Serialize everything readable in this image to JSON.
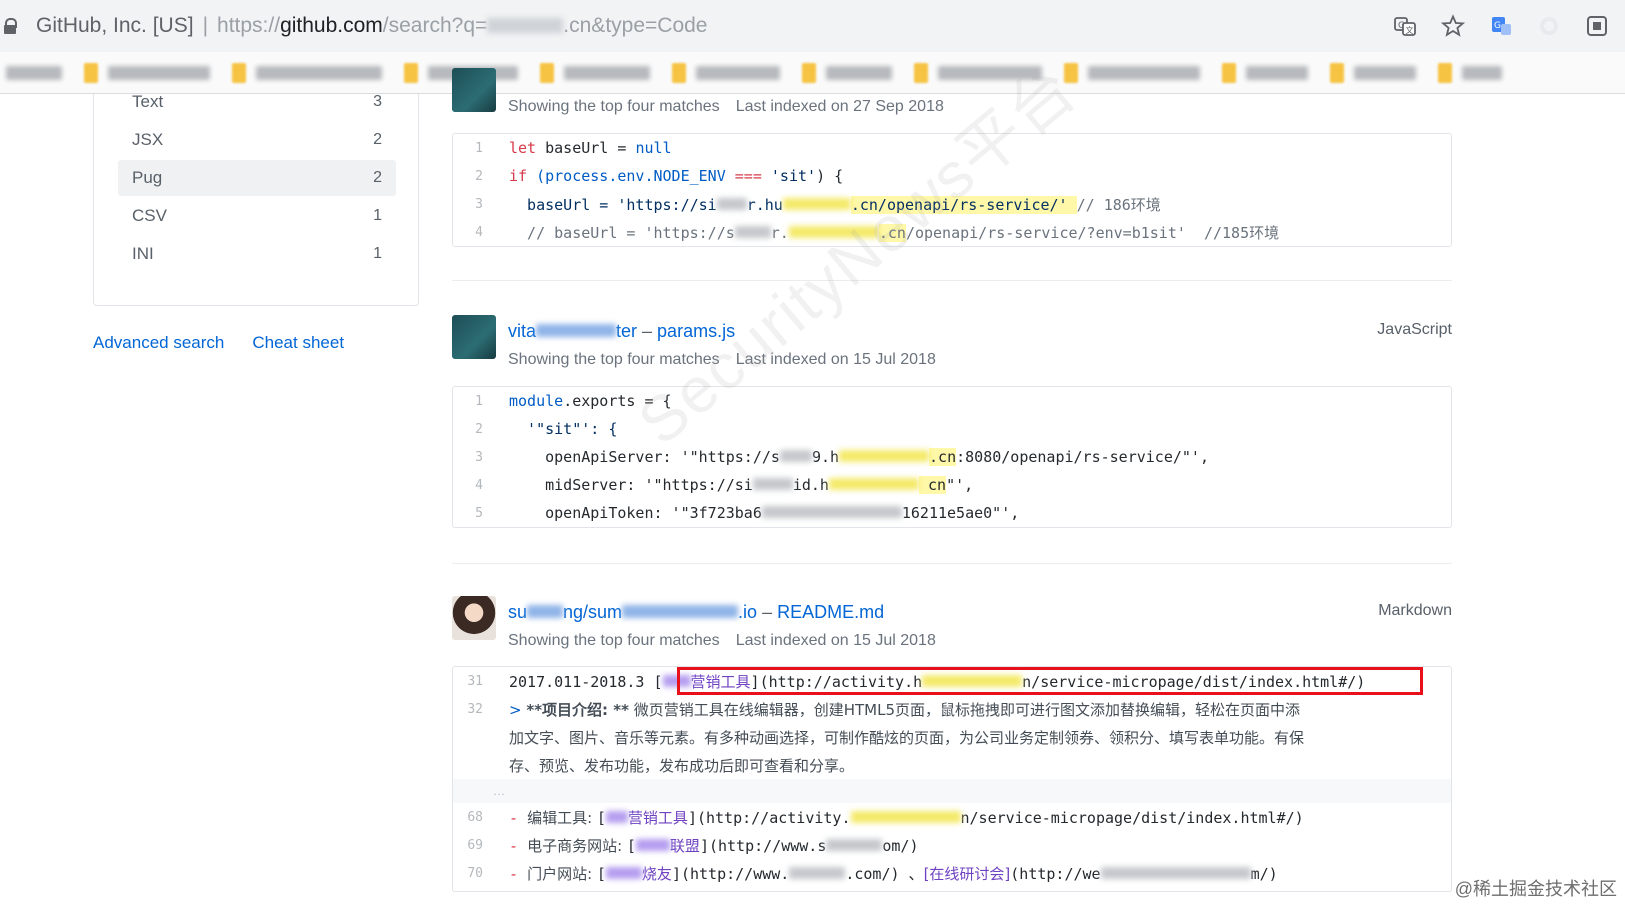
{
  "browser": {
    "site_identity": "GitHub, Inc. [US]",
    "url_prefix": "https://",
    "url_domain": "github.com",
    "url_path": "/search?q=",
    "url_suffix": ".cn&type=Code",
    "icons": [
      "translate-icon",
      "star-icon",
      "extension-icon",
      "profile-icon",
      "window-icon"
    ]
  },
  "bookmarks_bar": {
    "folder_count": 12
  },
  "sidebar": {
    "languages": [
      {
        "name": "Text",
        "count": "3"
      },
      {
        "name": "JSX",
        "count": "2"
      },
      {
        "name": "Pug",
        "count": "2",
        "selected": true
      },
      {
        "name": "CSV",
        "count": "1"
      },
      {
        "name": "INI",
        "count": "1"
      }
    ],
    "advanced_search": "Advanced search",
    "cheat_sheet": "Cheat sheet"
  },
  "results": [
    {
      "meta_matches": "Showing the top four matches",
      "meta_indexed": "Last indexed on 27 Sep 2018",
      "lines": [
        {
          "n": "1",
          "a": "let",
          "b": " baseUrl = ",
          "c": "null"
        },
        {
          "n": "2",
          "a": "if",
          "b": " (process.env.",
          "c": "NODE_ENV",
          "d": " === ",
          "e": "'sit'",
          "f": ") {"
        },
        {
          "n": "3",
          "a": "  baseUrl = 'https://si",
          "b": "r.hu",
          "c": ".cn/openapi/rs-service/' ",
          "d": "// 186环境"
        },
        {
          "n": "4",
          "a": "  // baseUrl = 'https://s",
          "b": "r.",
          "c": ".cn",
          "d": "/openapi/rs-service/?env=b1sit'  //185环境"
        }
      ]
    },
    {
      "repo_prefix": "vita",
      "repo_suffix": "ter",
      "separator": " – ",
      "file": "params.js",
      "language": "JavaScript",
      "meta_matches": "Showing the top four matches",
      "meta_indexed": "Last indexed on 15 Jul 2018",
      "lines": [
        {
          "n": "1",
          "a": "module",
          "b": ".exports = {"
        },
        {
          "n": "2",
          "a": "  '\"sit\"': {"
        },
        {
          "n": "3",
          "a": "    openApiServer: '\"https://s",
          "b": "9.h",
          "c": ".cn",
          "d": ":8080/openapi/rs-service/\"',"
        },
        {
          "n": "4",
          "a": "    midServer: '\"https://si",
          "b": "id.h",
          "c": " cn",
          "d": "\"',"
        },
        {
          "n": "5",
          "a": "    openApiToken: '\"3f723ba6",
          "b": "16211e5ae0\"',"
        }
      ]
    },
    {
      "repo_prefix": "su",
      "repo_mid": "ng/sum",
      "repo_suffix": ".io",
      "separator": " – ",
      "file": "README.md",
      "language": "Markdown",
      "meta_matches": "Showing the top four matches",
      "meta_indexed": "Last indexed on 15 Jul 2018",
      "lines": [
        {
          "n": "31",
          "a": "2017.011-2018.3 ",
          "b": "[",
          "c": "营销工具",
          "d": "](http://activity.h",
          "e": "n/service-micropage/dist/index.html#/)"
        },
        {
          "n": "32",
          "a": "> ",
          "b": "**项目介绍: **",
          "c": " 微页营销工具在线编辑器，创建HTML5页面，鼠标拖拽即可进行图文添加替换编辑，轻松在页面中添"
        },
        {
          "n": "",
          "a": "加文字、图片、音乐等元素。有多种动画选择，可制作酷炫的页面，为公司业务定制领券、领积分、填写表单功能。有保"
        },
        {
          "n": "",
          "a": "存、预览、发布功能，发布成功后即可查看和分享。"
        },
        {
          "n": "68",
          "a": "- ",
          "b": "编辑工具: ",
          "c": "[",
          "d": "营销工具",
          "e": "](http://activity.",
          "f": "n/service-micropage/dist/index.html#/)"
        },
        {
          "n": "69",
          "a": "- ",
          "b": "电子商务网站: ",
          "c": "[",
          "d": "联盟",
          "e": "](http://www.s",
          "f": "om/)"
        },
        {
          "n": "70",
          "a": "- ",
          "b": "门户网站: ",
          "c": "[",
          "d": "烧友",
          "e": "](http://www.",
          "f": ".com/) 、",
          "g": "[在线研讨会]",
          "h": "(http://we",
          "i": "m/)"
        }
      ],
      "ellipsis": "…"
    }
  ],
  "watermark": "SecurityNews平台",
  "credit": "@稀土掘金技术社区"
}
